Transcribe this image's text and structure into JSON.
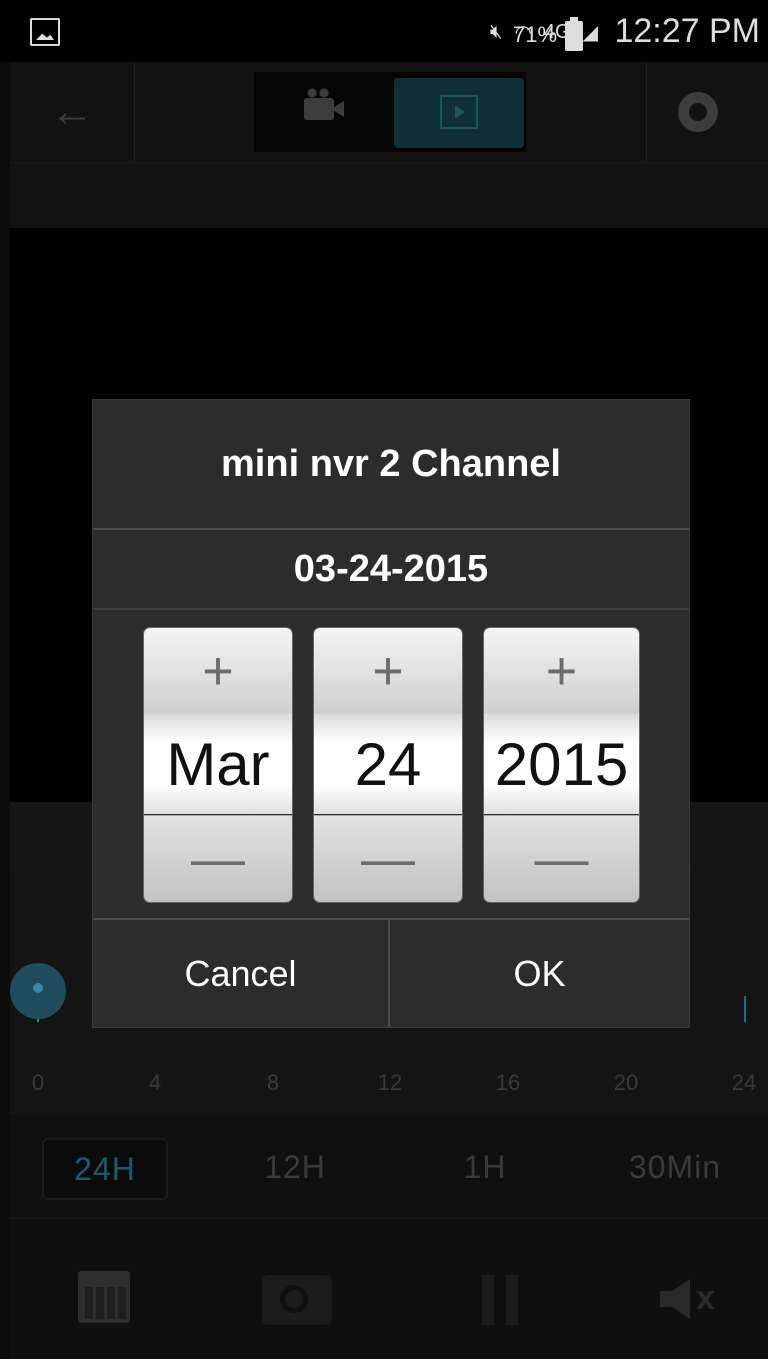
{
  "status_bar": {
    "battery_percent": "71%",
    "time": "12:27 PM",
    "network": "4G"
  },
  "toolbar": {
    "icons": [
      "back-arrow-icon",
      "video-camera-icon",
      "film-playback-icon",
      "gear-icon"
    ],
    "active_mode": "playback"
  },
  "dialog": {
    "title": "mini nvr 2 Channel",
    "date": "03-24-2015",
    "month": {
      "plus": "+",
      "value": "Mar",
      "minus": "—"
    },
    "day": {
      "plus": "+",
      "value": "24",
      "minus": "—"
    },
    "year": {
      "plus": "+",
      "value": "2015",
      "minus": "—"
    },
    "cancel": "Cancel",
    "ok": "OK"
  },
  "timeline": {
    "hours": [
      "0",
      "4",
      "8",
      "12",
      "16",
      "20",
      "24"
    ]
  },
  "ranges": {
    "r24": "24H",
    "r12": "12H",
    "r1": "1H",
    "r30": "30Min",
    "active": "24H"
  },
  "bottom_bar": {
    "icons": [
      "calendar-icon",
      "snapshot-camera-icon",
      "pause-icon",
      "mute-icon"
    ],
    "mute_glyph": "x"
  }
}
